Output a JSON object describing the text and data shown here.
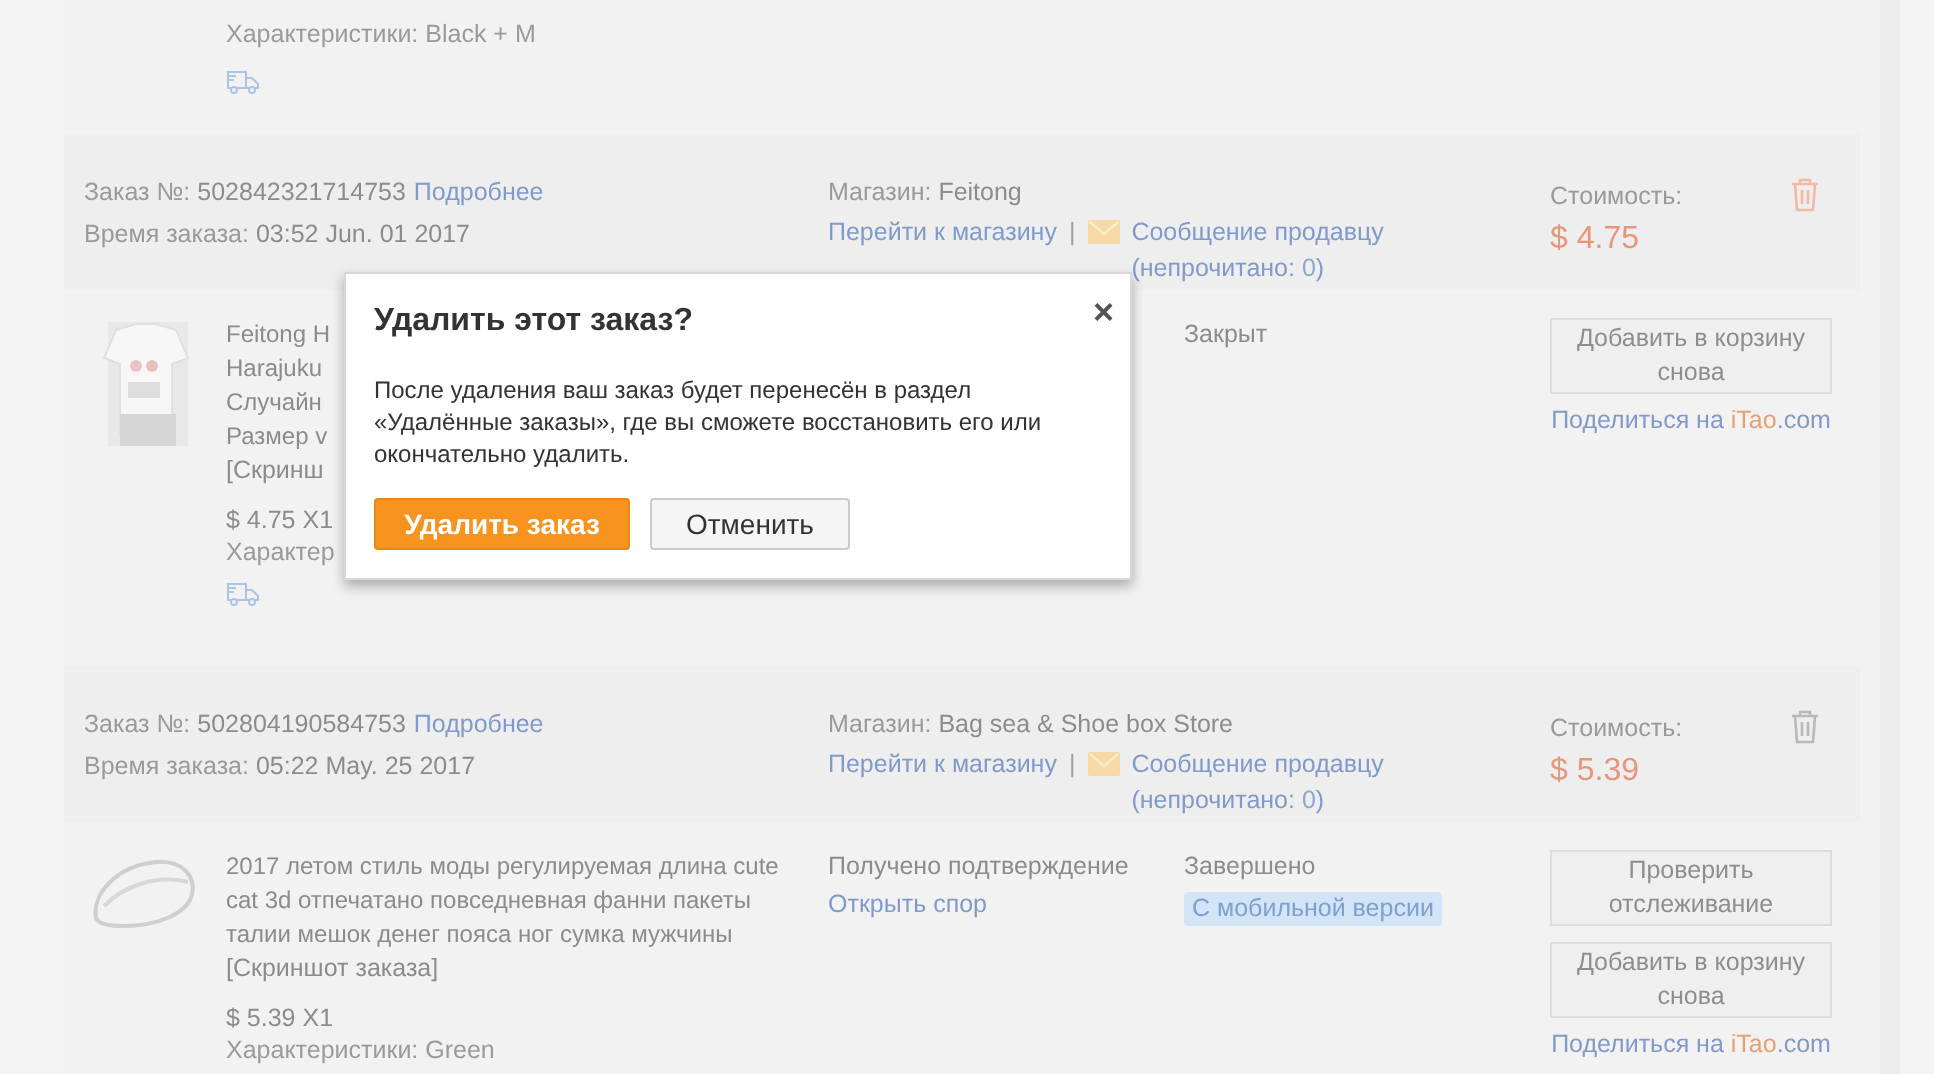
{
  "top_item": {
    "specs": "Характеристики: Black + M"
  },
  "orders": [
    {
      "number_label": "Заказ №:",
      "number": "502842321714753",
      "details_link": "Подробнее",
      "time_label": "Время заказа:",
      "time": "03:52 Jun. 01 2017",
      "store_label": "Магазин:",
      "store": "Feitong",
      "store_link": "Перейти к магазину",
      "separator": "|",
      "message_link": "Сообщение продавцу",
      "unread_label": "(непрочитано:",
      "unread_count": "0",
      "unread_close": ")",
      "cost_label": "Стоимость:",
      "cost": "$ 4.75",
      "delete_highlighted": true,
      "item": {
        "title_lines": [
          "Feitong H",
          "Harajuku",
          "Случайн",
          "Размер v"
        ],
        "screenshot_link": "[Скринш",
        "price": "$ 4.75 X1",
        "specs": "Характер",
        "shipping_icon": true,
        "state": "Закрыт",
        "buttons": [
          "Добавить в корзину снова"
        ],
        "share_prefix": "Поделиться на",
        "share_brand": "iTao",
        "share_suffix": ".com"
      }
    },
    {
      "number_label": "Заказ №:",
      "number": "502804190584753",
      "details_link": "Подробнее",
      "time_label": "Время заказа:",
      "time": "05:22 May. 25 2017",
      "store_label": "Магазин:",
      "store": "Bag sea & Shoe box Store",
      "store_link": "Перейти к магазину",
      "separator": "|",
      "message_link": "Сообщение продавцу",
      "unread_label": "(непрочитано:",
      "unread_count": "0",
      "unread_close": ")",
      "cost_label": "Стоимость:",
      "cost": "$ 5.39",
      "delete_highlighted": false,
      "item": {
        "title_lines": [
          "2017 летом стиль моды регулируемая длина cute cat 3d отпечатано повседневная фанни пакеты талии мешок денег пояса ног сумка мужчины"
        ],
        "screenshot_link": "[Скриншот заказа]",
        "price": "$ 5.39 X1",
        "specs": "Характеристики: Green",
        "status": [
          "Получено подтверждение",
          "Открыть спор"
        ],
        "state": "Завершено",
        "mobile_badge": "С мобильной версии",
        "buttons": [
          "Проверить отслеживание",
          "Добавить в корзину снова"
        ],
        "share_prefix": "Поделиться на",
        "share_brand": "iTao",
        "share_suffix": ".com"
      }
    }
  ],
  "dialog": {
    "title": "Удалить этот заказ?",
    "close": "×",
    "text": "После удаления ваш заказ будет перенесён в раздел «Удалённые заказы», где вы сможете восстановить его или окончательно удалить.",
    "confirm": "Удалить заказ",
    "cancel": "Отменить"
  }
}
